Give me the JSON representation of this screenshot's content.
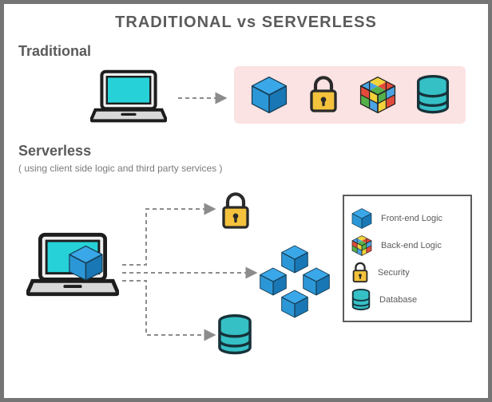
{
  "title": "TRADITIONAL vs SERVERLESS",
  "sections": {
    "traditional": {
      "label": "Traditional"
    },
    "serverless": {
      "label": "Serverless",
      "subnote": "( using client side logic and third party services )"
    }
  },
  "legend": {
    "frontend": "Front-end Logic",
    "backend": "Back-end Logic",
    "security": "Security",
    "database": "Database"
  }
}
